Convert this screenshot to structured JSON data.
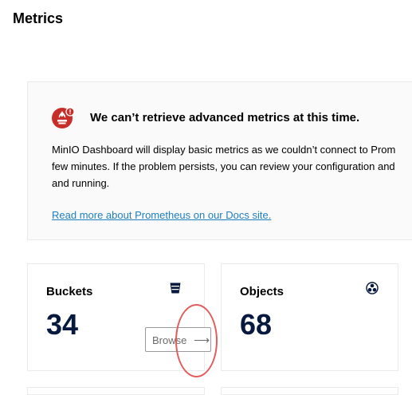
{
  "header": {
    "title": "Metrics"
  },
  "alert": {
    "icon": "prometheus-warning-icon",
    "title": "We can’t retrieve advanced metrics at this time.",
    "body_lines": [
      "MinIO Dashboard will display basic metrics as we couldn’t connect to Prom",
      "few minutes. If the problem persists, you can review your configuration and",
      "and running."
    ],
    "link_text": "Read more about Prometheus on our Docs site."
  },
  "cards": {
    "buckets": {
      "label": "Buckets",
      "value": "34",
      "icon": "bucket-icon",
      "browse_label": "Browse",
      "browse_icon": "arrow-right-icon"
    },
    "objects": {
      "label": "Objects",
      "value": "68",
      "icon": "objects-icon"
    }
  },
  "colors": {
    "accent": "#c72e29",
    "link": "#1c7fc1",
    "value_text": "#07193e",
    "annotation": "#e25c5c"
  }
}
